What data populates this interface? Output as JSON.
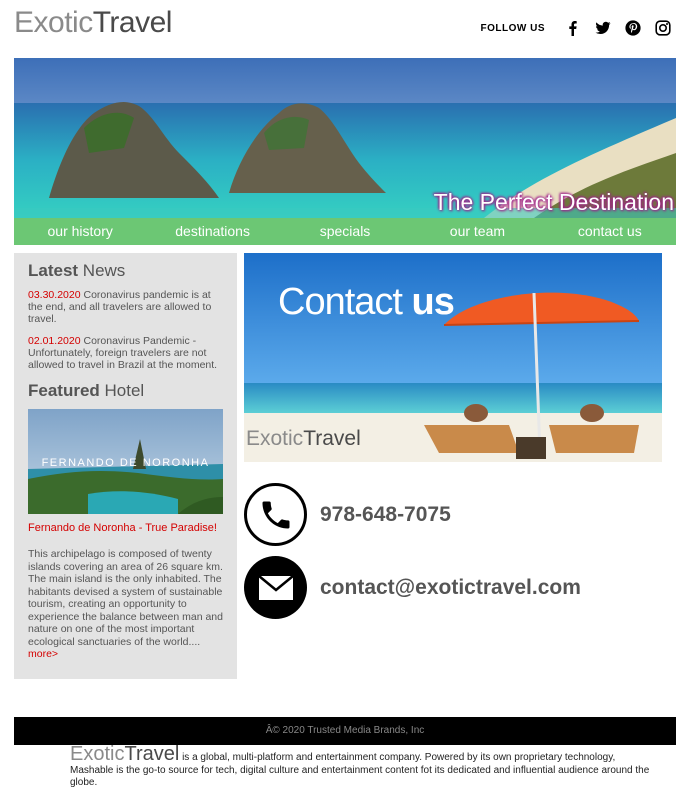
{
  "header": {
    "logo_part1": "Exotic",
    "logo_part2": "Travel",
    "follow_label": "FOLLOW US",
    "social_icons": [
      "facebook-icon",
      "twitter-icon",
      "pinterest-icon",
      "instagram-icon"
    ]
  },
  "hero": {
    "caption": "The Perfect Destination"
  },
  "nav": {
    "items": [
      "our history",
      "destinations",
      "specials",
      "our team",
      "contact us"
    ]
  },
  "sidebar": {
    "latest_bold": "Latest",
    "latest_rest": " News",
    "news": [
      {
        "date": "03.30.2020",
        "text": " Coronavirus pandemic is at the end, and all travelers are allowed to travel."
      },
      {
        "date": "02.01.2020",
        "text": " Coronavirus Pandemic - Unfortunately, foreign travelers are not allowed to travel in Brazil at the moment."
      }
    ],
    "featured_bold": "Featured",
    "featured_rest": " Hotel",
    "hotel_image_text": "FERNANDO DE NORONHA",
    "hotel_link": "Fernando de Noronha - True Paradise!",
    "hotel_desc": "This archipelago is composed of twenty islands covering an area of 26 square km. The main island is the only inhabited. The habitants devised a system of sustainable tourism, creating an opportunity to experience the balance between man and nature on one of the most important ecological sanctuaries of the world....",
    "more": "more>"
  },
  "banner": {
    "title_part1": "Contact ",
    "title_part2": "us",
    "logo_part1": "Exotic",
    "logo_part2": "Travel"
  },
  "contact": {
    "phone": "978-648-7075",
    "email": "contact@exotictravel.com",
    "icons": [
      "phone-icon",
      "mail-icon"
    ]
  },
  "footer": {
    "copyright": "Â© 2020 Trusted Media Brands, Inc",
    "logo_part1": "Exotic",
    "logo_part2": "Travel",
    "about": " is a global, multi-platform and entertainment company. Powered by its own proprietary technology, Mashable is the go-to source for tech, digital culture and entertainment content fot its dedicated and influential audience around the globe."
  },
  "colors": {
    "nav_green": "#6cc774",
    "accent_red": "#d40000",
    "sidebar_gray": "#e3e3e3"
  }
}
